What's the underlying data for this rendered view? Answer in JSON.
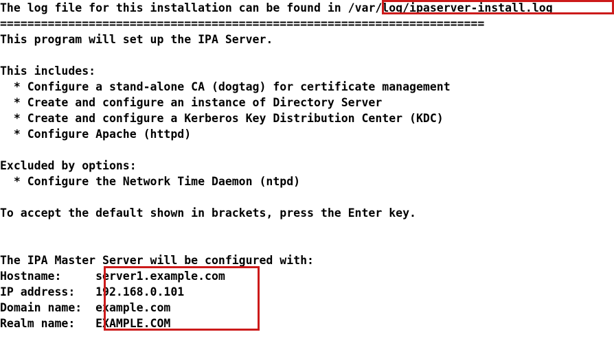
{
  "terminal": {
    "log_notice": {
      "prefix": "The log file for this installation can be found in ",
      "path": "/var/log/ipaserver-install.log"
    },
    "separator": "=======================================================================",
    "intro": "This program will set up the IPA Server.",
    "blank": "",
    "includes_heading": "This includes:",
    "includes_items": [
      "  * Configure a stand-alone CA (dogtag) for certificate management",
      "  * Create and configure an instance of Directory Server",
      "  * Create and configure a Kerberos Key Distribution Center (KDC)",
      "  * Configure Apache (httpd)"
    ],
    "excluded_heading": "Excluded by options:",
    "excluded_items": [
      "  * Configure the Network Time Daemon (ntpd)"
    ],
    "accept_default": "To accept the default shown in brackets, press the Enter key.",
    "master_heading": "The IPA Master Server will be configured with:",
    "config_rows": [
      {
        "label": "Hostname:",
        "value": "server1.example.com"
      },
      {
        "label": "IP address:",
        "value": "192.168.0.101"
      },
      {
        "label": "Domain name:",
        "value": "example.com"
      },
      {
        "label": "Realm name:",
        "value": "EXAMPLE.COM"
      }
    ],
    "config_lines": [
      "Hostname:     server1.example.com",
      "IP address:   192.168.0.101",
      "Domain name:  example.com",
      "Realm name:   EXAMPLE.COM"
    ],
    "colors": {
      "background": "#ffffff",
      "foreground": "#000000",
      "highlight": "#cc1a1a"
    }
  }
}
